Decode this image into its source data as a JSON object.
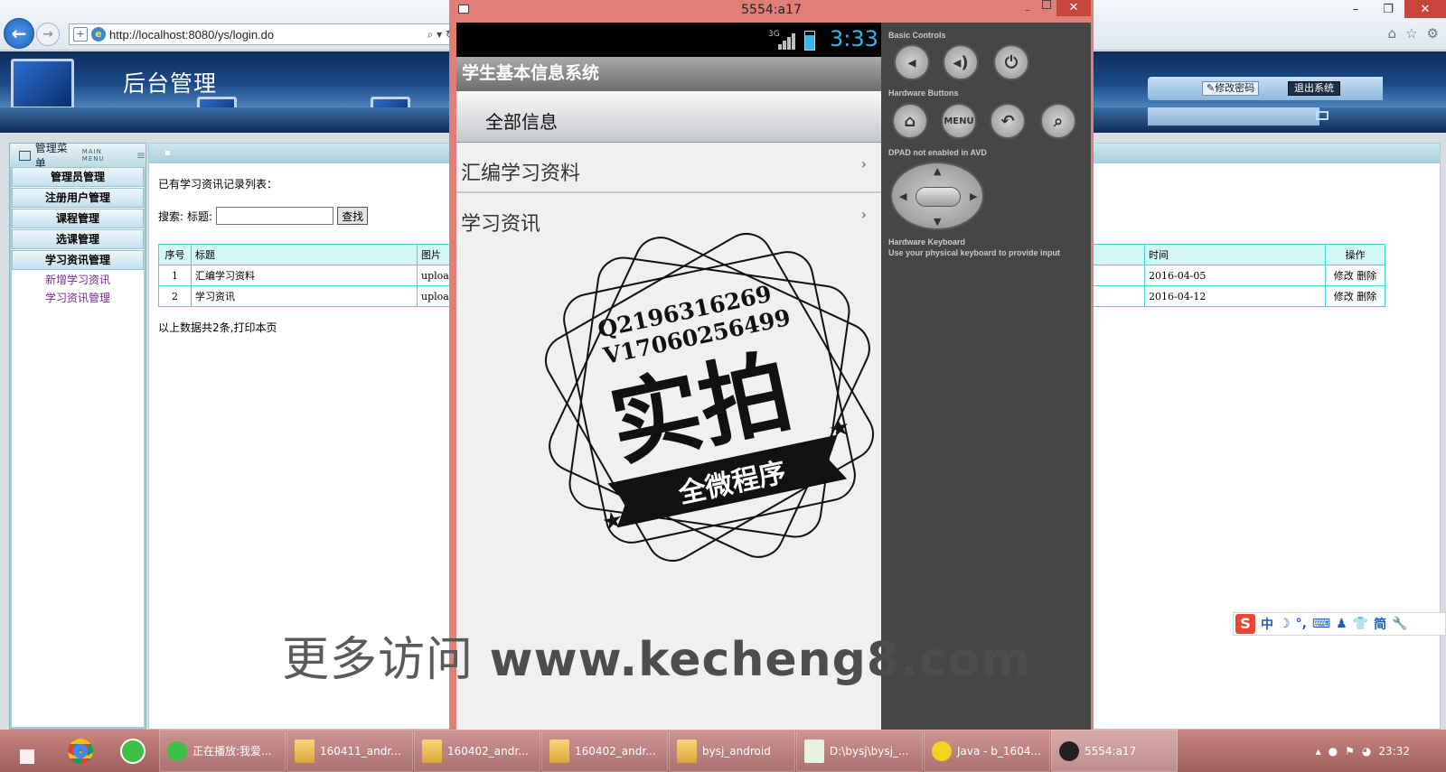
{
  "browser": {
    "address": "http://localhost:8080/ys/login.do",
    "back_icon": "back-arrow-icon",
    "forward_icon": "forward-arrow-icon"
  },
  "site": {
    "title": "后台管理",
    "change_password": "修改密码",
    "logout": "退出系统"
  },
  "sidebar": {
    "title": "管理菜单",
    "subtitle": "MAIN MENU",
    "groups": [
      {
        "label": "管理员管理"
      },
      {
        "label": "注册用户管理"
      },
      {
        "label": "课程管理"
      },
      {
        "label": "选课管理"
      },
      {
        "label": "学习资讯管理"
      }
    ],
    "sub_items": [
      {
        "label": "新增学习资讯"
      },
      {
        "label": "学习资讯管理"
      }
    ]
  },
  "main": {
    "caption": "已有学习资讯记录列表：",
    "search_label": "搜索:",
    "title_label": "标题:",
    "search_value": "",
    "search_button": "查找",
    "summary": "以上数据共2条,打印本页",
    "table": {
      "headers": [
        "序号",
        "标题",
        "图片",
        "时间",
        "操作"
      ],
      "rows": [
        {
          "no": "1",
          "title": "汇编学习资料",
          "img": "uploa",
          "time": "2016-04-05",
          "edit": "修改",
          "delete": "删除"
        },
        {
          "no": "2",
          "title": "学习资讯",
          "img": "uploa",
          "time": "2016-04-12",
          "edit": "修改",
          "delete": "删除"
        }
      ]
    }
  },
  "emulator": {
    "window_title": "5554:a17",
    "status_network": "3G",
    "status_time": "3:33",
    "app_title": "学生基本信息系统",
    "tab_all": "全部信息",
    "list": [
      {
        "label": "汇编学习资料"
      },
      {
        "label": "学习资讯"
      }
    ],
    "controls": {
      "basic_controls": "Basic Controls",
      "hardware_buttons": "Hardware Buttons",
      "dpad_caption": "DPAD not enabled in AVD",
      "keyboard_caption": "Hardware Keyboard",
      "keyboard_hint": "Use your physical keyboard to provide input",
      "menu_label": "MENU"
    }
  },
  "overlay": {
    "qq": "Q2196316269",
    "wechat": "V17060256499",
    "stamp_main": "实拍",
    "stamp_banner": "全微程序",
    "watermark_prefix": "更多访问",
    "watermark_url": "www.kecheng8.com"
  },
  "ime": {
    "logo": "S",
    "lang": "中",
    "simplified": "简"
  },
  "taskbar": {
    "tasks": [
      {
        "label": "正在播放:我爱..."
      },
      {
        "label": "160411_andr..."
      },
      {
        "label": "160402_andr..."
      },
      {
        "label": "160402_andr..."
      },
      {
        "label": "bysj_android"
      },
      {
        "label": "D:\\bysj\\bysj_..."
      },
      {
        "label": "Java - b_1604..."
      },
      {
        "label": "5554:a17"
      }
    ],
    "clock": "23:32"
  },
  "colors": {
    "table_border": "#4bd1d1",
    "header_blue": "#1b4a8a",
    "status_time": "#33b5e5",
    "taskbar": "#b5706d"
  }
}
